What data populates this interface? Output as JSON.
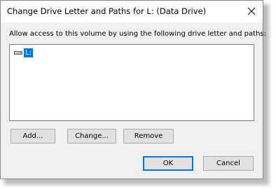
{
  "dialog": {
    "title": "Change Drive Letter and Paths for L: (Data Drive)",
    "instruction": "Allow access to this volume by using the following drive letter and paths:"
  },
  "list": {
    "items": [
      {
        "label": "L:",
        "icon": "drive-icon",
        "selected": true
      }
    ]
  },
  "buttons": {
    "add": "Add...",
    "change": "Change...",
    "remove": "Remove",
    "ok": "OK",
    "cancel": "Cancel"
  },
  "colors": {
    "selection": "#0078d7",
    "dialog_bg": "#f0f0f0",
    "button_bg": "#e1e1e1"
  }
}
